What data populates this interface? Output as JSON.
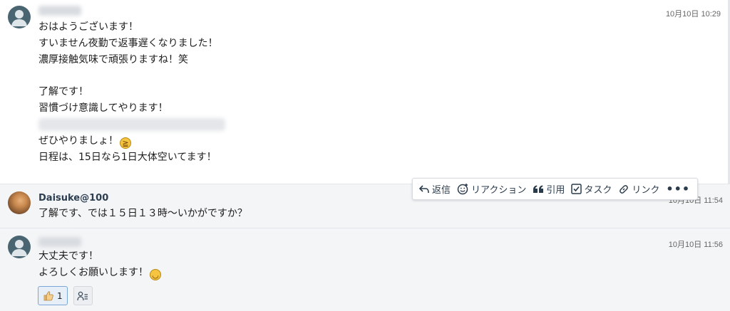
{
  "messages": [
    {
      "sender": "",
      "time": "10月10日 10:29",
      "lines_a": "おはようございます！\nすいません夜勤で返事遅くなりました！\n濃厚接触気味で頑張りますね！笑\n\n了解です！\n習慣づけ意識してやります！\n",
      "line_emoji": "ぜひやりましょ！",
      "emoji_a": "laughing-face",
      "line_last": "日程は、15日なら1日大体空いてます！"
    },
    {
      "sender": "Daisuke@100",
      "time": "10月10日 11:54",
      "text": "了解です、では１５日１３時〜いかがですか？"
    },
    {
      "sender": "",
      "time": "10月10日 11:56",
      "line1": "大丈夫です！",
      "line2": "よろしくお願いします！",
      "emoji_b": "smiling-face"
    }
  ],
  "toolbar": {
    "reply": "返信",
    "reaction": "リアクション",
    "quote": "引用",
    "task": "タスク",
    "link": "リンク",
    "more": "•••"
  },
  "reaction": {
    "icon": "thumbs-up-icon",
    "count": "1"
  },
  "colors": {
    "accent": "#2c5a8c",
    "reaction_border": "#7ca6d6",
    "background_alt": "#f4f5f7"
  }
}
